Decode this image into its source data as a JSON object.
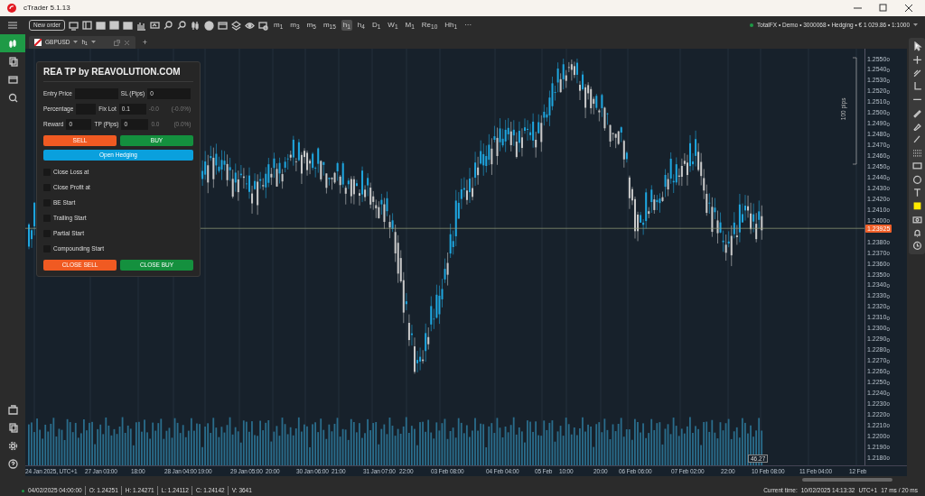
{
  "window": {
    "title": "cTrader 5.1.13"
  },
  "toolbar": {
    "new_order": "New order",
    "timeframes": [
      {
        "label": "m$_{1}$",
        "selected": false
      },
      {
        "label": "m$_{3}$",
        "selected": false
      },
      {
        "label": "m$_{5}$",
        "selected": false
      },
      {
        "label": "m$_{15}$",
        "selected": false
      },
      {
        "label": "h$_{1}$",
        "selected": true
      },
      {
        "label": "h$_{4}$",
        "selected": false
      },
      {
        "label": "D$_{1}$",
        "selected": false
      },
      {
        "label": "W$_{1}$",
        "selected": false
      },
      {
        "label": "M$_{1}$",
        "selected": false
      },
      {
        "label": "Re$_{10}$",
        "selected": false
      },
      {
        "label": "Hh$_{1}$",
        "selected": false
      }
    ],
    "more": "···",
    "account": "TotalFX • Demo • 3000068 • Hedging • € 1 029.86 • 1:1000",
    "connected": true
  },
  "chart_tab": {
    "symbol": "GBPUSD",
    "timeframe": "h$_{1}$",
    "add": "+"
  },
  "panel": {
    "title": "REA TP by REAVOLUTION.COM",
    "rows": [
      {
        "label": "Entry Price",
        "value": "",
        "label_2": "SL (Pips)",
        "value_2": "0"
      },
      {
        "label": "Percentage",
        "value": "",
        "label_2": "Fix Lot",
        "value_2": "0.1",
        "reading": "-0.0",
        "reading_2": "(-0.0%)"
      },
      {
        "label": "Reward",
        "value": "0",
        "label_2": "TP (Pips)",
        "value_2": "0",
        "reading": "0.0",
        "reading_2": "(0.0%)"
      }
    ],
    "sell": "SELL",
    "buy": "BUY",
    "hedge": "Open Hedging",
    "options": [
      {
        "label": "Close Loss at",
        "checked": false
      },
      {
        "label": "Close Profit at",
        "checked": false
      },
      {
        "label": "BE Start",
        "checked": false
      },
      {
        "label": "Trailing Start",
        "checked": false
      },
      {
        "label": "Partial Start",
        "checked": false
      },
      {
        "label": "Compounding Start",
        "checked": false
      }
    ],
    "close_sell": "CLOSE SELL",
    "close_buy": "CLOSE BUY"
  },
  "price_axis": {
    "labels_above": [
      "1.2550$_{0}$",
      "1.2540$_{0}$",
      "1.2530$_{0}$",
      "1.2520$_{0}$",
      "1.2510$_{0}$",
      "1.2500$_{0}$",
      "1.2490$_{0}$",
      "1.2480$_{0}$",
      "1.2470$_{0}$",
      "1.2460$_{0}$",
      "1.2450$_{0}$",
      "1.2440$_{0}$",
      "1.2430$_{0}$",
      "1.2420$_{0}$",
      "1.2410$_{0}$",
      "1.2400$_{0}$"
    ],
    "labels_below": [
      "1.2380$_{0}$",
      "1.2370$_{0}$",
      "1.2360$_{0}$",
      "1.2350$_{0}$",
      "1.2340$_{0}$",
      "1.2330$_{0}$",
      "1.2320$_{0}$",
      "1.2310$_{0}$",
      "1.2300$_{0}$",
      "1.2290$_{0}$",
      "1.2280$_{0}$",
      "1.2270$_{0}$",
      "1.2260$_{0}$",
      "1.2250$_{0}$",
      "1.2240$_{0}$",
      "1.2230$_{0}$",
      "1.2220$_{0}$",
      "1.2210$_{0}$",
      "1.2200$_{0}$",
      "1.2190$_{0}$",
      "1.2180$_{0}$"
    ],
    "current_price": "1.23925",
    "measure": "100 pips",
    "volume_tag": "46.27"
  },
  "time_axis": [
    "24 Jan 2025, UTC+1",
    "27 Jan 03:00",
    "18:00",
    "28 Jan 04:00",
    "19:00",
    "29 Jan 05:00",
    "20:00",
    "30 Jan 06:00",
    "21:00",
    "31 Jan 07:00",
    "22:00",
    "03 Feb 08:00",
    "04 Feb 04:00",
    "05 Feb",
    "10:00",
    "20:00",
    "06 Feb 06:00",
    "07 Feb 02:00",
    "22:00",
    "10 Feb 08:00",
    "11 Feb 04:00",
    "12 Feb"
  ],
  "status_bar": {
    "bar_time": "04/02/2025 04:00:00",
    "open": "O: 1.24251",
    "high": "H: 1.24271",
    "low": "L: 1.24112",
    "close": "C: 1.24142",
    "volume": "V: 3641",
    "current_time_label": "Current time:",
    "current_time": "10/02/2025 14:13:32",
    "timezone": "UTC+1",
    "latency": "17 ms / 20 ms"
  }
}
